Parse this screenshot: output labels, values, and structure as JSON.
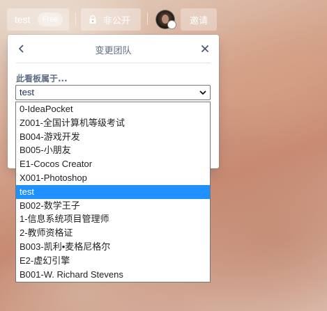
{
  "header": {
    "board_name": "test",
    "plan_badge": "Free",
    "visibility_label": "非公开",
    "invite_label": "邀请"
  },
  "popover": {
    "title": "变更团队",
    "field_label": "此看板属于...",
    "selected_value": "test",
    "options": [
      "0-IdeaPocket",
      "Z001-全国计算机等级考试",
      "B004-游戏开发",
      "B005-小朋友",
      "E1-Cocos Creator",
      "X001-Photoshop",
      "test",
      "B002-数学王子",
      "1-信息系统项目管理师",
      "2-教师资格证",
      "B003-凯利•麦格尼格尔",
      "E2-虚幻引擎",
      "B001-W. Richard Stevens"
    ],
    "highlighted_index": 6
  },
  "colors": {
    "highlight": "#1e90ff",
    "header_button_bg": "rgba(255,255,255,0.32)",
    "popover_title": "#5e6c84"
  },
  "icons": {
    "back": "chevron-left-icon",
    "close": "close-icon",
    "caret": "chevron-down-icon",
    "visibility": "lock-icon"
  }
}
